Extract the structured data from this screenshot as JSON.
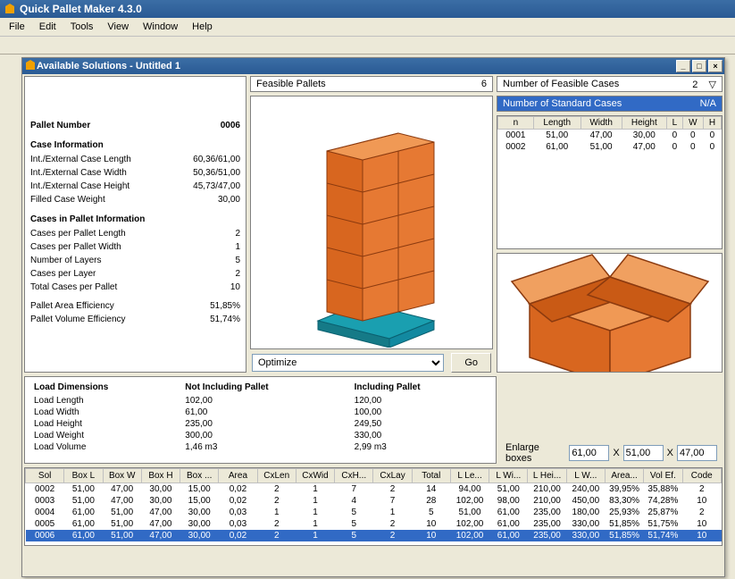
{
  "app_title": "Quick Pallet Maker 4.3.0",
  "menu": [
    "File",
    "Edit",
    "Tools",
    "View",
    "Window",
    "Help"
  ],
  "child_title": "Available Solutions - Untitled 1",
  "feasible_pallets": {
    "label": "Feasible Pallets",
    "value": "6"
  },
  "feasible_cases": {
    "label": "Number of Feasible Cases",
    "value": "2"
  },
  "standard_cases": {
    "label": "Number of Standard Cases",
    "value": "N/A"
  },
  "info": {
    "pallet_number_label": "Pallet Number",
    "pallet_number": "0006",
    "case_info_heading": "Case Information",
    "case_rows": [
      {
        "l": "Int./External Case Length",
        "v": "60,36/61,00"
      },
      {
        "l": "Int./External Case Width",
        "v": "50,36/51,00"
      },
      {
        "l": "Int./External Case Height",
        "v": "45,73/47,00"
      },
      {
        "l": "Filled Case Weight",
        "v": "30,00"
      }
    ],
    "pallet_info_heading": "Cases in Pallet Information",
    "pallet_rows": [
      {
        "l": "Cases per Pallet Length",
        "v": "2"
      },
      {
        "l": "Cases per Pallet Width",
        "v": "1"
      },
      {
        "l": "Number of Layers",
        "v": "5"
      },
      {
        "l": "Cases per Layer",
        "v": "2"
      },
      {
        "l": "Total Cases per Pallet",
        "v": "10"
      }
    ],
    "eff_rows": [
      {
        "l": "Pallet Area Efficiency",
        "v": "51,85%"
      },
      {
        "l": "Pallet Volume Efficiency",
        "v": "51,74%"
      }
    ]
  },
  "cases_table": {
    "headers": [
      "n",
      "Length",
      "Width",
      "Height",
      "L",
      "W",
      "H"
    ],
    "rows": [
      [
        "0001",
        "51,00",
        "47,00",
        "30,00",
        "0",
        "0",
        "0"
      ],
      [
        "0002",
        "61,00",
        "51,00",
        "47,00",
        "0",
        "0",
        "0"
      ]
    ]
  },
  "optimize_label": "Optimize",
  "go_label": "Go",
  "load": {
    "h1": "Load Dimensions",
    "h2": "Not Including Pallet",
    "h3": "Including Pallet",
    "rows": [
      {
        "l": "Load Length",
        "a": "102,00",
        "b": "120,00"
      },
      {
        "l": "Load Width",
        "a": "61,00",
        "b": "100,00"
      },
      {
        "l": "Load Height",
        "a": "235,00",
        "b": "249,50"
      },
      {
        "l": "Load Weight",
        "a": "300,00",
        "b": "330,00"
      },
      {
        "l": "Load Volume",
        "a": "1,46 m3",
        "b": "2,99 m3"
      }
    ]
  },
  "enlarge": {
    "label": "Enlarge boxes",
    "x": "X",
    "v1": "61,00",
    "v2": "51,00",
    "v3": "47,00"
  },
  "results": {
    "headers": [
      "Sol",
      "Box L",
      "Box W",
      "Box H",
      "Box ...",
      "Area",
      "CxLen",
      "CxWid",
      "CxH...",
      "CxLay",
      "Total",
      "L Le...",
      "L Wi...",
      "L Hei...",
      "L W...",
      "Area...",
      "Vol Ef.",
      "Code"
    ],
    "rows": [
      [
        "0002",
        "51,00",
        "47,00",
        "30,00",
        "15,00",
        "0,02",
        "2",
        "1",
        "7",
        "2",
        "14",
        "94,00",
        "51,00",
        "210,00",
        "240,00",
        "39,95%",
        "35,88%",
        "2"
      ],
      [
        "0003",
        "51,00",
        "47,00",
        "30,00",
        "15,00",
        "0,02",
        "2",
        "1",
        "4",
        "7",
        "28",
        "102,00",
        "98,00",
        "210,00",
        "450,00",
        "83,30%",
        "74,28%",
        "10"
      ],
      [
        "0004",
        "61,00",
        "51,00",
        "47,00",
        "30,00",
        "0,03",
        "1",
        "1",
        "5",
        "1",
        "5",
        "51,00",
        "61,00",
        "235,00",
        "180,00",
        "25,93%",
        "25,87%",
        "2"
      ],
      [
        "0005",
        "61,00",
        "51,00",
        "47,00",
        "30,00",
        "0,03",
        "2",
        "1",
        "5",
        "2",
        "10",
        "102,00",
        "61,00",
        "235,00",
        "330,00",
        "51,85%",
        "51,75%",
        "10"
      ],
      [
        "0006",
        "61,00",
        "51,00",
        "47,00",
        "30,00",
        "0,02",
        "2",
        "1",
        "5",
        "2",
        "10",
        "102,00",
        "61,00",
        "235,00",
        "330,00",
        "51,85%",
        "51,74%",
        "10"
      ]
    ],
    "selected": 4
  }
}
